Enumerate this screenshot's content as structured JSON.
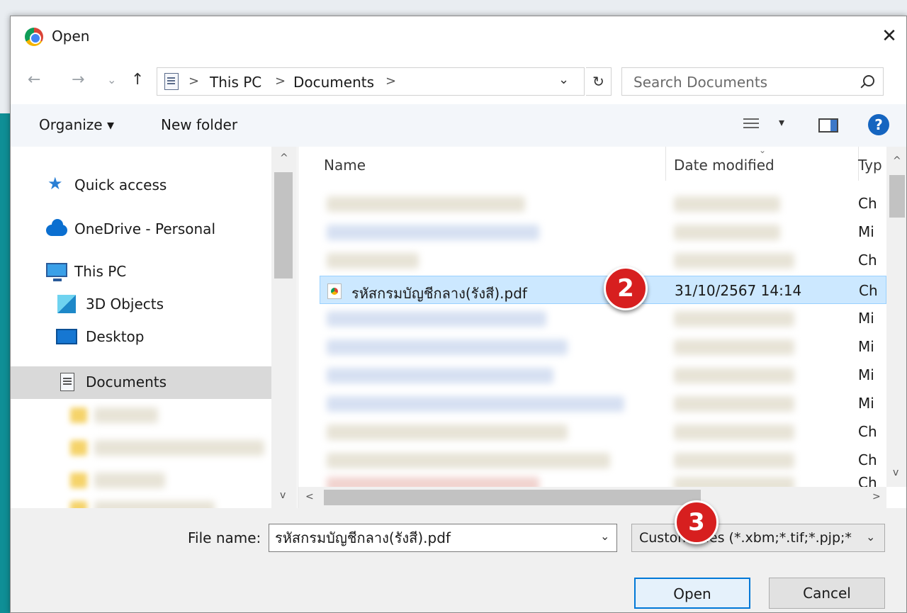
{
  "window": {
    "title": "Open",
    "close": "✕"
  },
  "nav": {
    "back": "←",
    "forward": "→",
    "recent": "⌄",
    "up": "↑",
    "refresh": "↻",
    "breadcrumbs": [
      "This PC",
      "Documents"
    ],
    "sep": ">",
    "dropdown": "⌄"
  },
  "search": {
    "placeholder": "Search Documents"
  },
  "toolbar": {
    "organize": "Organize ▾",
    "new_folder": "New folder",
    "view_drop": "▾",
    "help": "?"
  },
  "sidebar": {
    "items": [
      {
        "label": "Quick access",
        "icon": "star-icon"
      },
      {
        "label": "OneDrive - Personal",
        "icon": "cloud-icon"
      },
      {
        "label": "This PC",
        "icon": "computer-icon"
      },
      {
        "label": "3D Objects",
        "icon": "cube-icon"
      },
      {
        "label": "Desktop",
        "icon": "desktop-icon"
      },
      {
        "label": "Documents",
        "icon": "document-icon"
      }
    ],
    "up_arrow": "^",
    "down_arrow": "v"
  },
  "filelist": {
    "columns": {
      "name": "Name",
      "date": "Date modified",
      "type": "Typ"
    },
    "sort_caret": "⌄",
    "type_values": [
      "Ch",
      "Mi",
      "Ch",
      "Ch",
      "Mi",
      "Mi",
      "Mi",
      "Mi",
      "Ch",
      "Ch",
      "Ch"
    ],
    "selected": {
      "name": "รหัสกรมบัญชีกลาง(รังสี).pdf",
      "date": "31/10/2567 14:14"
    },
    "scroll_up": "^",
    "scroll_down": "v",
    "scroll_left": "<",
    "scroll_right": ">"
  },
  "footer": {
    "file_name_label": "File name:",
    "file_name_value": "รหัสกรมบัญชีกลาง(รังสี).pdf",
    "file_type": "Custom Files (*.xbm;*.tif;*.pjp;*",
    "dropdown": "⌄",
    "open": "Open",
    "cancel": "Cancel"
  },
  "annotations": [
    "2",
    "3"
  ],
  "colors": {
    "accent": "#0078d7",
    "selection": "#cce8ff",
    "badge": "#d71f1f"
  }
}
